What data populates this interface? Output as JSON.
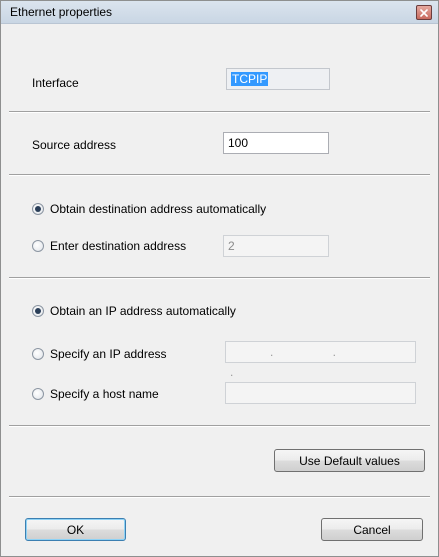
{
  "window": {
    "title": "Ethernet properties"
  },
  "interface": {
    "label": "Interface",
    "value": "TCPIP"
  },
  "source": {
    "label": "Source address",
    "value": "100"
  },
  "destination": {
    "auto_label": "Obtain destination address automatically",
    "manual_label": "Enter destination address",
    "manual_value": "2",
    "selected": "auto"
  },
  "ip": {
    "auto_label": "Obtain an IP address automatically",
    "specify_label": "Specify an IP address",
    "specify_value": ". . .",
    "host_label": "Specify a host name",
    "host_value": "",
    "selected": "auto"
  },
  "buttons": {
    "defaults": "Use Default values",
    "ok": "OK",
    "cancel": "Cancel"
  },
  "colors": {
    "selection": "#3399ff",
    "dialog_bg": "#f0f0f0",
    "titlebar": "#c9d6e4"
  },
  "icons": {
    "close": "close-icon"
  }
}
